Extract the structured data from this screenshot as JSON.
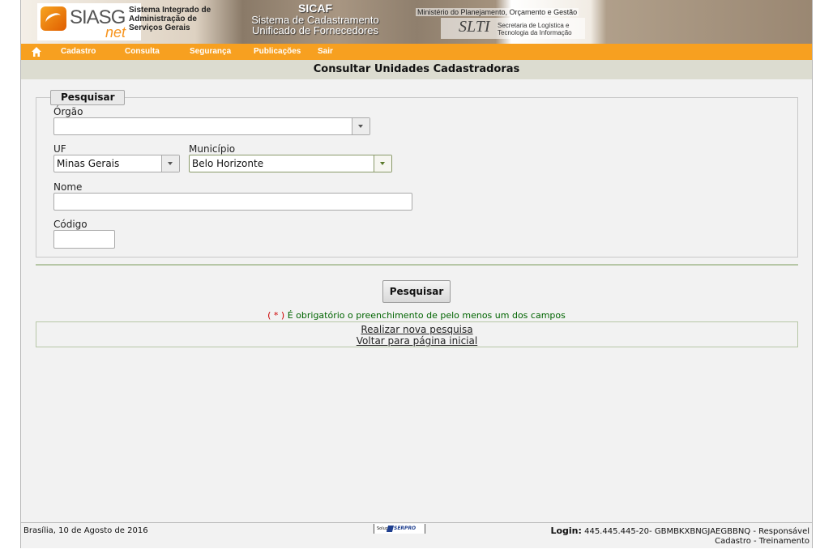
{
  "banner": {
    "logo_text": "SIASG",
    "logo_net": "net",
    "logo_caption": [
      "Sistema Integrado de",
      "Administração de",
      "Serviços Gerais"
    ],
    "sicaf_title": "SICAF",
    "sicaf_line1": "Sistema de Cadastramento",
    "sicaf_line2": "Unificado de Fornecedores",
    "ministerio": "Ministério do Planejamento, Orçamento e Gestão",
    "slti_logo": "SLTI",
    "slti_caption": [
      "Secretaria de Logística e",
      "Tecnologia da Informação"
    ]
  },
  "menu": {
    "items": [
      "Cadastro",
      "Consulta",
      "Segurança",
      "Publicações",
      "Sair"
    ]
  },
  "page": {
    "title": "Consultar Unidades Cadastradoras"
  },
  "form": {
    "legend": "Pesquisar",
    "orgao_label": "Órgão",
    "orgao_value": "",
    "uf_label": "UF",
    "uf_value": "Minas Gerais",
    "municipio_label": "Município",
    "municipio_value": "Belo Horizonte",
    "nome_label": "Nome",
    "nome_value": "",
    "codigo_label": "Código",
    "codigo_value": "",
    "submit_label": "Pesquisar",
    "notice_asterisk": "( * )",
    "notice_text": " É obrigatório o preenchimento de pelo menos um dos campos"
  },
  "links": {
    "new_search": "Realizar nova pesquisa",
    "back_home": "Voltar para página inicial"
  },
  "footer": {
    "date": "Brasília, 10 de Agosto de 2016",
    "solucao": "Solução",
    "serpro": "SERPRO",
    "login_label": "Login:",
    "login_value": "445.445.445-20- GBMBKXBNGJAEGBBNQ - Responsável",
    "login_line2": "Cadastro - Treinamento"
  },
  "colors": {
    "menu_orange": "#f7a020",
    "title_bar": "#dcdcd0",
    "notice_green": "#006400",
    "required_red": "#cc0000"
  }
}
